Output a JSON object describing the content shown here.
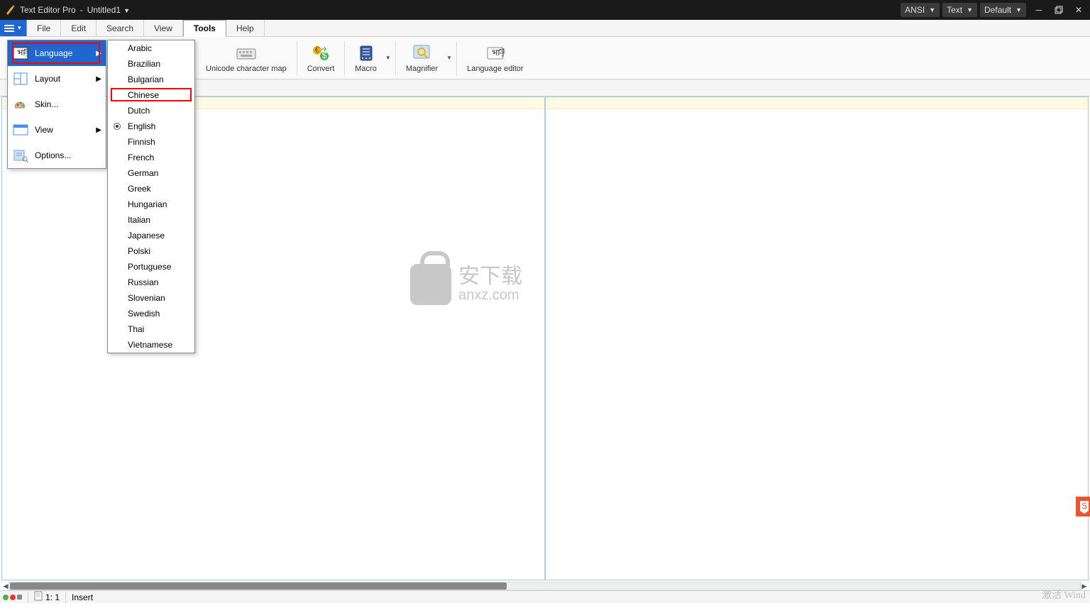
{
  "titlebar": {
    "app_name": "Text Editor Pro",
    "separator": "-",
    "document": "Untitled1",
    "combos": {
      "encoding": "ANSI",
      "mode": "Text",
      "theme": "Default"
    }
  },
  "menubar": {
    "items": [
      "File",
      "Edit",
      "Search",
      "View",
      "Tools",
      "Help"
    ],
    "active_index": 4
  },
  "ribbon": {
    "buttons": [
      {
        "label": "Unicode character map",
        "icon": "keyboard-icon"
      },
      {
        "label": "Convert",
        "icon": "convert-icon"
      },
      {
        "label": "Macro",
        "icon": "macro-icon",
        "has_dropdown": true
      },
      {
        "label": "Magnifier",
        "icon": "magnifier-icon",
        "has_dropdown": true
      },
      {
        "label": "Language editor",
        "icon": "language-editor-icon"
      }
    ]
  },
  "hamburger_menu": {
    "items": [
      {
        "label": "Language",
        "icon": "language-icon",
        "submenu": true,
        "highlight": true
      },
      {
        "label": "Layout",
        "icon": "layout-icon",
        "submenu": true
      },
      {
        "label": "Skin...",
        "icon": "skin-icon"
      },
      {
        "label": "View",
        "icon": "view-icon",
        "submenu": true
      },
      {
        "label": "Options...",
        "icon": "options-icon"
      }
    ]
  },
  "language_menu": {
    "selected": "English",
    "highlighted_red": "Chinese",
    "items": [
      "Arabic",
      "Brazilian",
      "Bulgarian",
      "Chinese",
      "Dutch",
      "English",
      "Finnish",
      "French",
      "German",
      "Greek",
      "Hungarian",
      "Italian",
      "Japanese",
      "Polski",
      "Portuguese",
      "Russian",
      "Slovenian",
      "Swedish",
      "Thai",
      "Vietnamese"
    ]
  },
  "statusbar": {
    "position": "1: 1",
    "mode": "Insert"
  },
  "watermark": {
    "text_cn": "安下载",
    "text_en": "anxz.com"
  },
  "activation_hint": "激活 Wind"
}
